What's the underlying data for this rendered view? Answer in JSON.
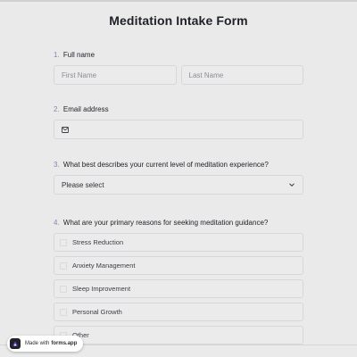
{
  "form": {
    "title": "Meditation Intake Form"
  },
  "q1": {
    "number": "1.",
    "label": "Full name",
    "first_placeholder": "First Name",
    "last_placeholder": "Last Name"
  },
  "q2": {
    "number": "2.",
    "label": "Email address",
    "icon": "envelope-icon"
  },
  "q3": {
    "number": "3.",
    "label": "What best describes your current level of meditation experience?",
    "selected": "Please select",
    "icon": "chevron-down-icon"
  },
  "q4": {
    "number": "4.",
    "label": "What are your primary reasons for seeking meditation guidance?",
    "options": [
      "Stress Reduction",
      "Anxiety Management",
      "Sleep Improvement",
      "Personal Growth",
      "Other"
    ]
  },
  "badge": {
    "prefix": "Made with",
    "brand": "forms.app"
  },
  "colors": {
    "background": "#eaeaea",
    "number_accent": "#7f8aa6",
    "logo_accent": "#5b4bdb"
  }
}
